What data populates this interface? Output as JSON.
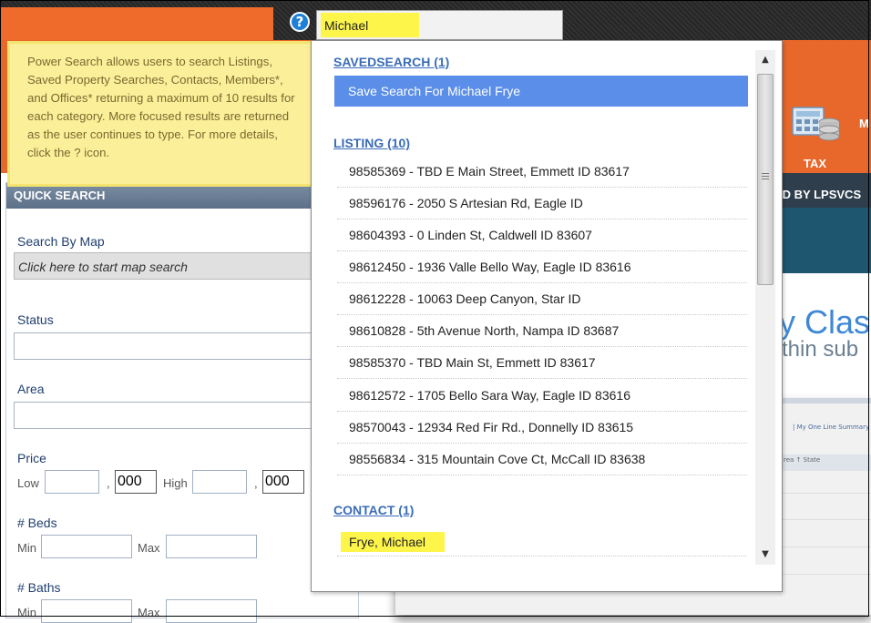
{
  "search": {
    "value": "Michael"
  },
  "help": {
    "glyph": "?"
  },
  "tooltip": {
    "text": "Power Search allows users to search Listings, Saved Property Searches, Contacts, Members*, and Offices* returning a maximum of 10 results for each category. More focused results are returned as the user continues to type. For more details, click the ? icon."
  },
  "header": {
    "tax_label": "TAX",
    "m_label": "M"
  },
  "right_side": {
    "header_text": "ED BY LPSVCS",
    "class_text": "y Class",
    "sub_text": "thin sub",
    "mini_link": "| My One Line Summary |",
    "mini_cols": "rea ↑        State"
  },
  "quick_search": {
    "title": "QUICK SEARCH",
    "map_label": "Search By Map",
    "map_placeholder": "Click here to start map search",
    "status_label": "Status",
    "area_label": "Area",
    "price_label": "Price",
    "low_label": "Low",
    "comma1": ",",
    "low_thousands": "000",
    "high_label": "High",
    "comma2": ",",
    "high_thousands": "000",
    "beds_label": "# Beds",
    "beds_min": "Min",
    "beds_max": "Max",
    "baths_label": "# Baths",
    "baths_min": "Min",
    "baths_max": "Max"
  },
  "dropdown": {
    "savedsearch_header": "SAVEDSEARCH (1)",
    "savedsearch_items": [
      "Save Search For Michael Frye"
    ],
    "listing_header": "LISTING (10)",
    "listing_items": [
      "98585369 - TBD E Main Street, Emmett ID 83617",
      "98596176 - 2050 S Artesian Rd, Eagle ID",
      "98604393 - 0 Linden St, Caldwell ID 83607",
      "98612450 - 1936 Valle Bello Way, Eagle ID 83616",
      "98612228 - 10063 Deep Canyon, Star ID",
      "98610828 - 5th Avenue North, Nampa ID 83687",
      "98585370 - TBD Main St, Emmett ID 83617",
      "98612572 - 1705 Bello Sara Way, Eagle ID 83616",
      "98570043 - 12934 Red Fir Rd., Donnelly ID 83615",
      "98556834 - 315 Mountain Cove Ct, McCall ID 83638"
    ],
    "contact_header": "CONTACT (1)",
    "contact_items": [
      "Frye, Michael"
    ]
  },
  "scrollbar": {
    "up_glyph": "▲",
    "down_glyph": "▼"
  },
  "colors": {
    "brand_orange": "#e8672a",
    "highlight_yellow": "#fdf54a",
    "selected_blue": "#5a8ee8",
    "link_blue": "#3a6cb8",
    "tooltip_bg": "#fbef9a"
  }
}
